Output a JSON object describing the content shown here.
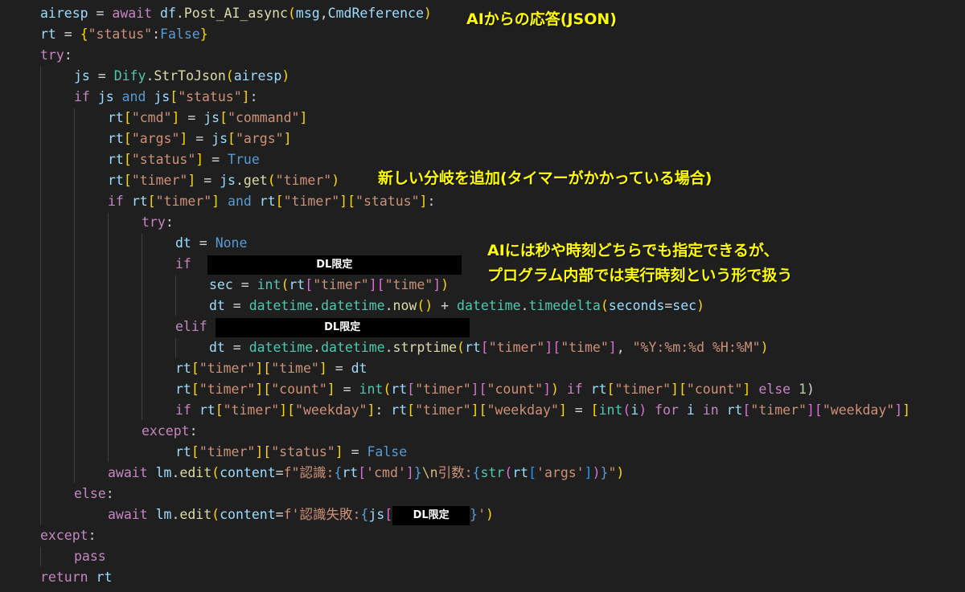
{
  "code": {
    "l1": {
      "a": "airesp",
      "b": "await",
      "c": "df",
      "d": "Post_AI_async",
      "e": "msg",
      "f": "CmdReference"
    },
    "l2": {
      "a": "rt",
      "b": "\"status\"",
      "c": "False"
    },
    "l3": {
      "a": "try"
    },
    "l4": {
      "a": "js",
      "b": "Dify",
      "c": "StrToJson",
      "d": "airesp"
    },
    "l5": {
      "a": "if",
      "b": "js",
      "c": "and",
      "d": "js",
      "e": "\"status\""
    },
    "l6": {
      "a": "rt",
      "b": "\"cmd\"",
      "c": "js",
      "d": "\"command\""
    },
    "l7": {
      "a": "rt",
      "b": "\"args\"",
      "c": "js",
      "d": "\"args\""
    },
    "l8": {
      "a": "rt",
      "b": "\"status\"",
      "c": "True"
    },
    "l9": {
      "a": "rt",
      "b": "\"timer\"",
      "c": "js",
      "d": "get",
      "e": "\"timer\""
    },
    "l10": {
      "a": "if",
      "b": "rt",
      "c": "\"timer\"",
      "d": "and",
      "e": "rt",
      "f": "\"timer\"",
      "g": "\"status\""
    },
    "l11": {
      "a": "try"
    },
    "l12": {
      "a": "dt",
      "b": "None"
    },
    "l13": {
      "a": "if",
      "redact": "DL限定"
    },
    "l14": {
      "a": "sec",
      "b": "int",
      "c": "rt",
      "d": "\"timer\"",
      "e": "\"time\""
    },
    "l15": {
      "a": "dt",
      "b": "datetime",
      "c": "datetime",
      "d": "now",
      "e": "datetime",
      "f": "timedelta",
      "g": "seconds",
      "h": "sec"
    },
    "l16": {
      "a": "elif",
      "redact": "DL限定"
    },
    "l17": {
      "a": "dt",
      "b": "datetime",
      "c": "datetime",
      "d": "strptime",
      "e": "rt",
      "f": "\"timer\"",
      "g": "\"time\"",
      "h": "\"%Y:%m:%d %H:%M\""
    },
    "l18": {
      "a": "rt",
      "b": "\"timer\"",
      "c": "\"time\"",
      "d": "dt"
    },
    "l19": {
      "a": "rt",
      "b": "\"timer\"",
      "c": "\"count\"",
      "d": "int",
      "e": "rt",
      "f": "\"timer\"",
      "g": "\"count\"",
      "h": "if",
      "i": "rt",
      "j": "\"timer\"",
      "k": "\"count\"",
      "l": "else",
      "m": "1"
    },
    "l20": {
      "a": "if",
      "b": "rt",
      "c": "\"timer\"",
      "d": "\"weekday\"",
      "e": "rt",
      "f": "\"timer\"",
      "g": "\"weekday\"",
      "h": "int",
      "i": "i",
      "j": "for",
      "k": "i",
      "l": "in",
      "m": "rt",
      "n": "\"timer\"",
      "o": "\"weekday\""
    },
    "l21": {
      "a": "except"
    },
    "l22": {
      "a": "rt",
      "b": "\"timer\"",
      "c": "\"status\"",
      "d": "False"
    },
    "l23": {
      "a": "await",
      "b": "lm",
      "c": "edit",
      "d": "content",
      "e": "f\"認識:",
      "f": "rt",
      "g": "'cmd'",
      "h": "\\n",
      "i": "引数:",
      "j": "str",
      "k": "rt",
      "l": "'args'",
      "m": "\""
    },
    "l24": {
      "a": "else"
    },
    "l25": {
      "a": "await",
      "b": "lm",
      "c": "edit",
      "d": "content",
      "e": "f'認識失敗:",
      "f": "js",
      "redact": "DL限定",
      "g": "'"
    },
    "l26": {
      "a": "except"
    },
    "l27": {
      "a": "pass"
    },
    "l28": {
      "a": "return",
      "b": "rt"
    }
  },
  "annotations": {
    "note1": "AIからの応答(JSON)",
    "note2": "新しい分岐を追加(タイマーがかかっている場合)",
    "note3_line1": "AIには秒や時刻どちらでも指定できるが、",
    "note3_line2": "プログラム内部では実行時刻という形で扱う"
  },
  "colors": {
    "background": "#1f1f1f",
    "keyword": "#569cd6",
    "control": "#c586c0",
    "variable": "#9cdcfe",
    "function": "#dcdcaa",
    "string": "#ce9178",
    "number": "#b5cea8",
    "annotation": "#ffff00"
  }
}
